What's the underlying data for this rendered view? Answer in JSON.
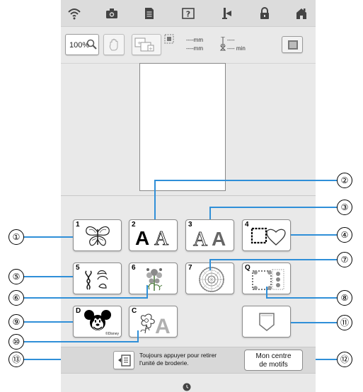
{
  "toolbar": {
    "icons": [
      "wifi-icon",
      "camera-icon",
      "document-icon",
      "help-icon",
      "needle-icon",
      "lock-icon",
      "home-icon"
    ]
  },
  "view": {
    "zoom_label": "100%",
    "width_value": "----mm",
    "height_value": "----mm",
    "stitch_count": "----",
    "time_value": "---- min"
  },
  "categories": [
    {
      "id": "1",
      "label": "1",
      "icon": "butterfly-pattern-icon"
    },
    {
      "id": "2",
      "label": "2",
      "icon": "alphabet-font-icon",
      "preview_text": "AA"
    },
    {
      "id": "3",
      "label": "3",
      "icon": "decorative-alphabet-icon",
      "preview_text": "AA"
    },
    {
      "id": "4",
      "label": "4",
      "icon": "frame-pattern-icon"
    },
    {
      "id": "5",
      "label": "5",
      "icon": "border-pattern-icon"
    },
    {
      "id": "6",
      "label": "6",
      "icon": "floral-alphabet-icon"
    },
    {
      "id": "7",
      "label": "7",
      "icon": "quilt-pattern-icon"
    },
    {
      "id": "Q",
      "label": "Q",
      "icon": "quilt-border-icon"
    },
    {
      "id": "D",
      "label": "D",
      "icon": "disney-icon",
      "sub_label": "©Disney"
    },
    {
      "id": "C",
      "label": "C",
      "icon": "couching-pattern-icon",
      "preview_text": "A"
    },
    {
      "id": "pocket",
      "label": "",
      "icon": "pocket-icon"
    }
  ],
  "callouts": [
    "①",
    "②",
    "③",
    "④",
    "⑤",
    "⑥",
    "⑦",
    "⑧",
    "⑨",
    "⑩",
    "⑪",
    "⑫",
    "⑬"
  ],
  "bottom": {
    "message": "Toujours appuyer pour retirer l'unité de broderie.",
    "my_center_line1": "Mon centre",
    "my_center_line2": "de motifs"
  },
  "colors": {
    "callout_line": "#2f8fd8",
    "screen_bg": "#e9e9e9"
  }
}
